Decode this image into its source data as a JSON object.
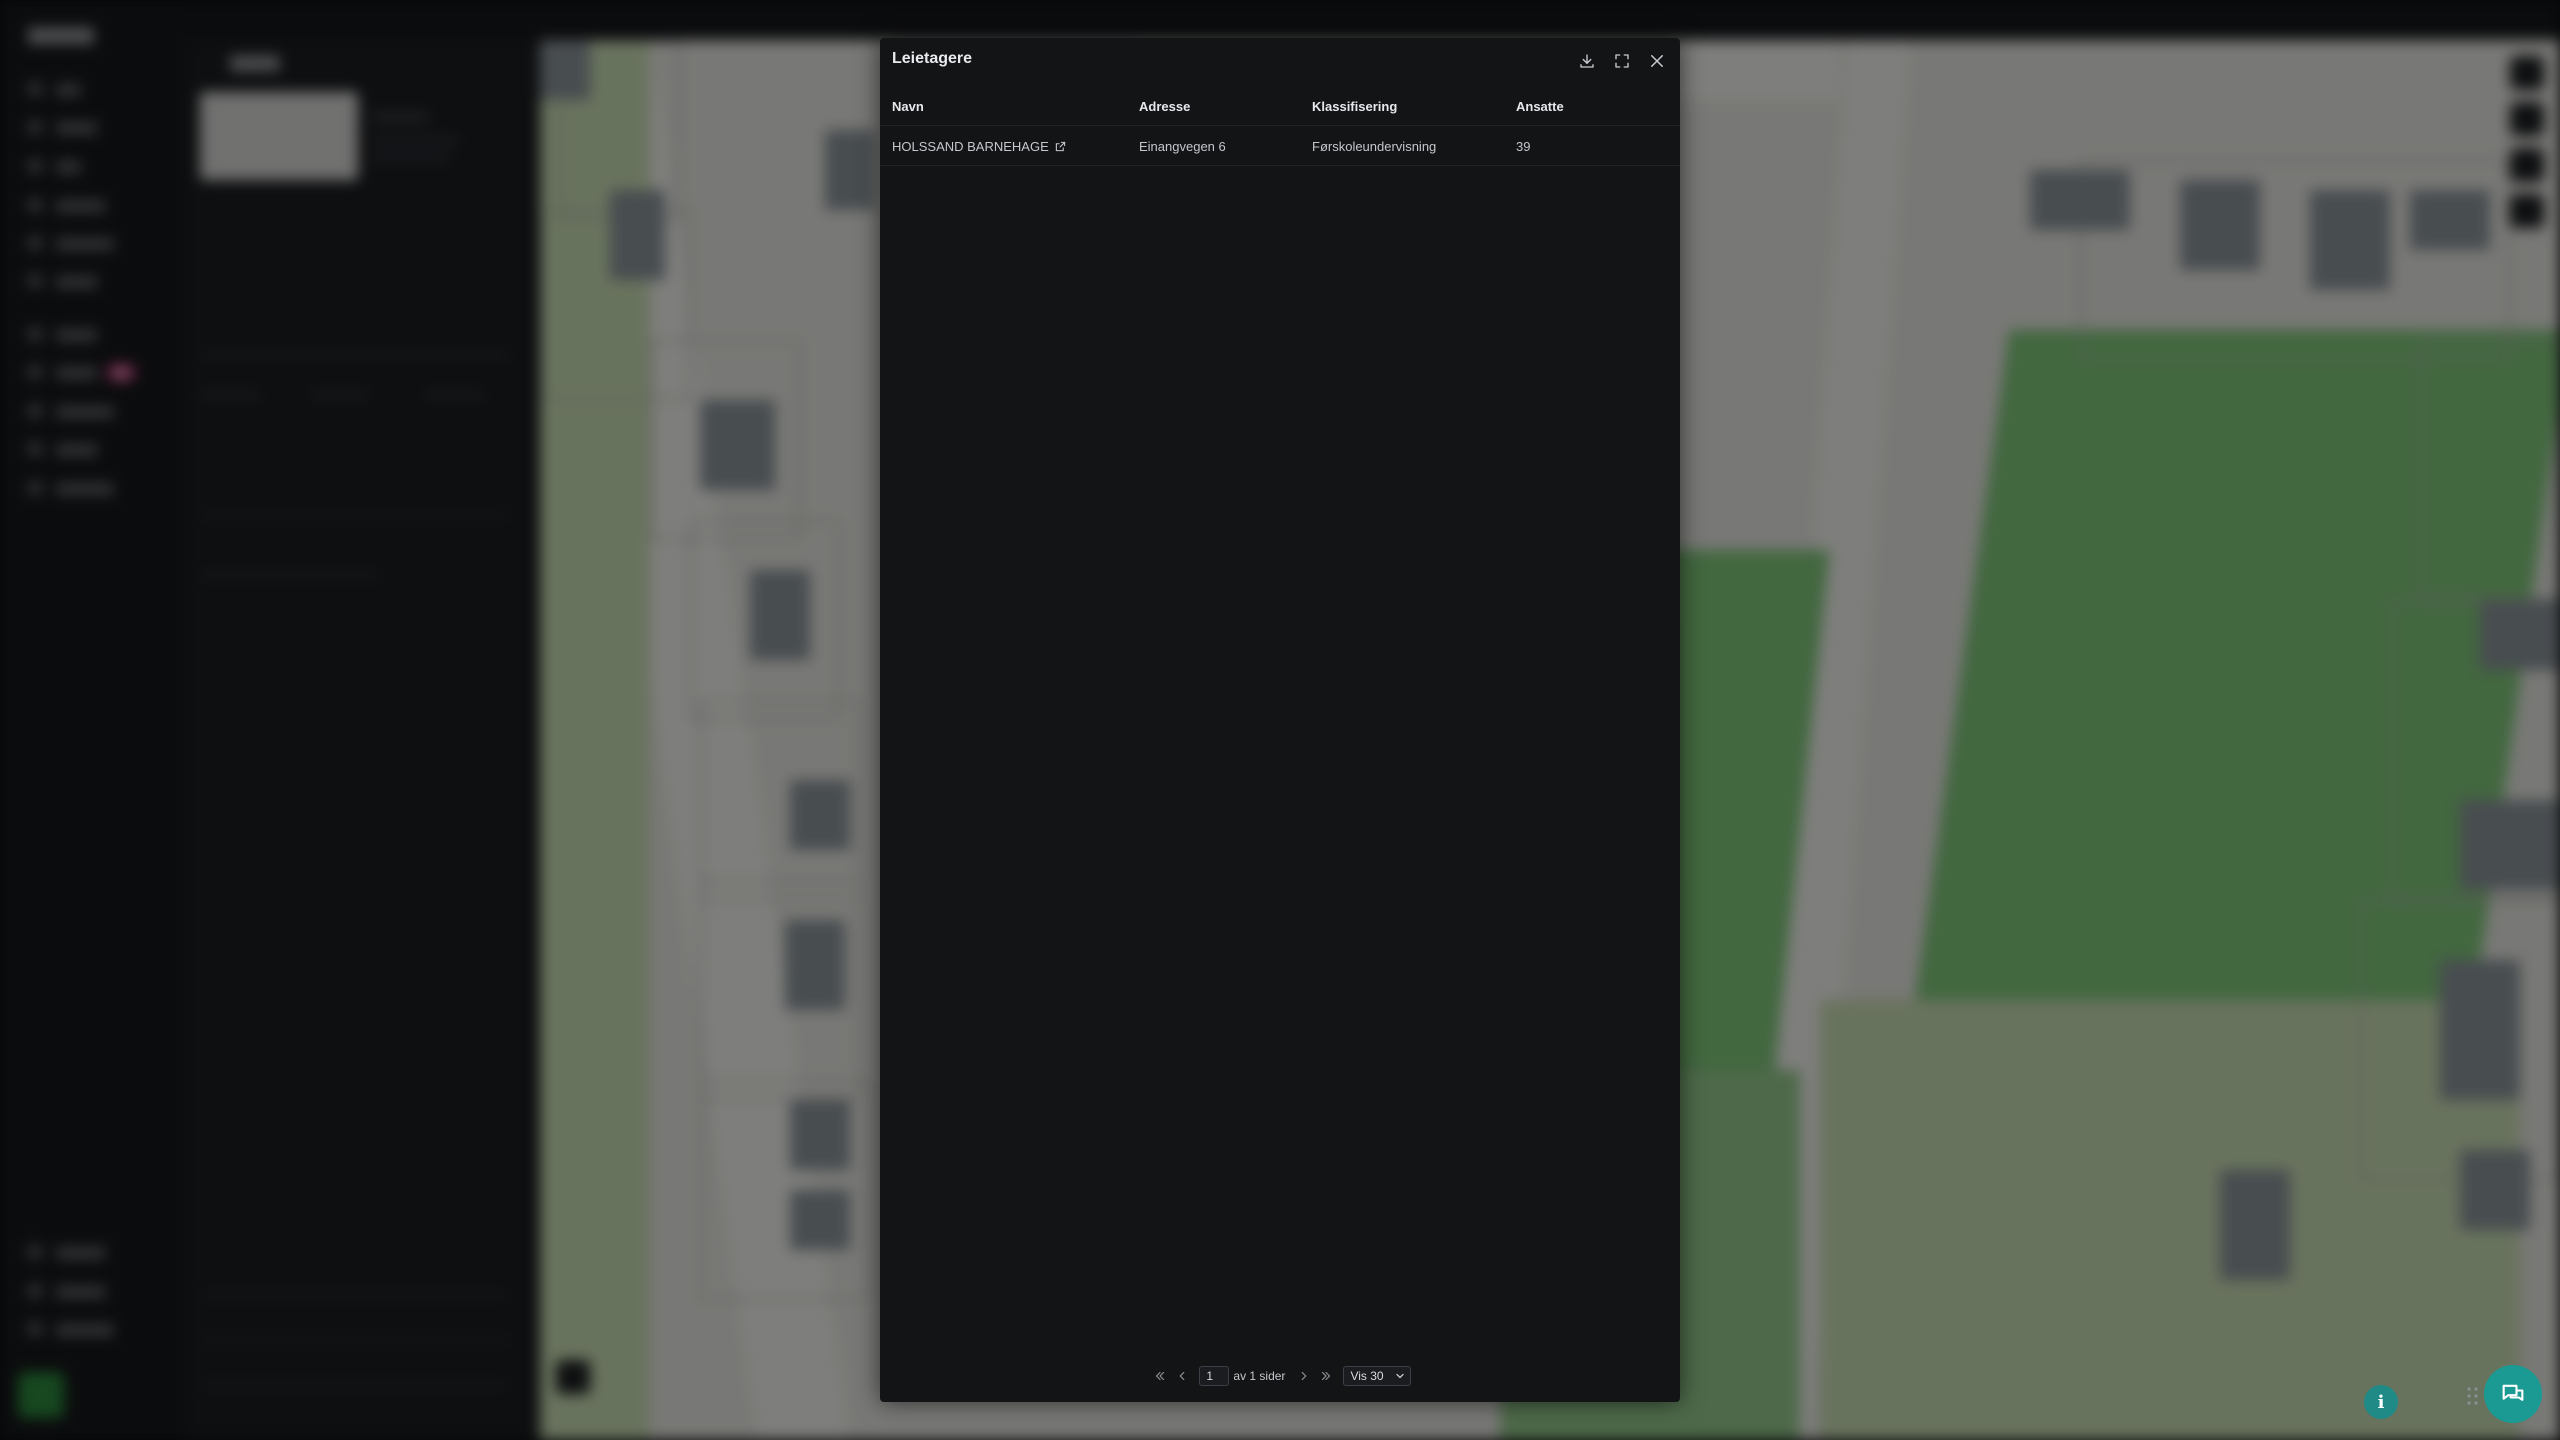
{
  "modal": {
    "title": "Leietagere",
    "icons": {
      "download": "download-icon",
      "expand": "expand-icon",
      "close": "close-icon"
    }
  },
  "table": {
    "columns": [
      "Navn",
      "Adresse",
      "Klassifisering",
      "Ansatte"
    ],
    "rows": [
      {
        "navn": "HOLSSAND BARNEHAGE",
        "adresse": "Einangvegen 6",
        "klassifisering": "Førskoleundervisning",
        "ansatte": "39"
      }
    ]
  },
  "pagination": {
    "current_page": "1",
    "of_label": "av 1 sider",
    "per_page_label": "Vis 30"
  },
  "floating": {
    "info_label": "i"
  },
  "colors": {
    "modal_bg": "#131416",
    "accent_teal": "#1a9a93",
    "map_green": "#7fc77a"
  }
}
